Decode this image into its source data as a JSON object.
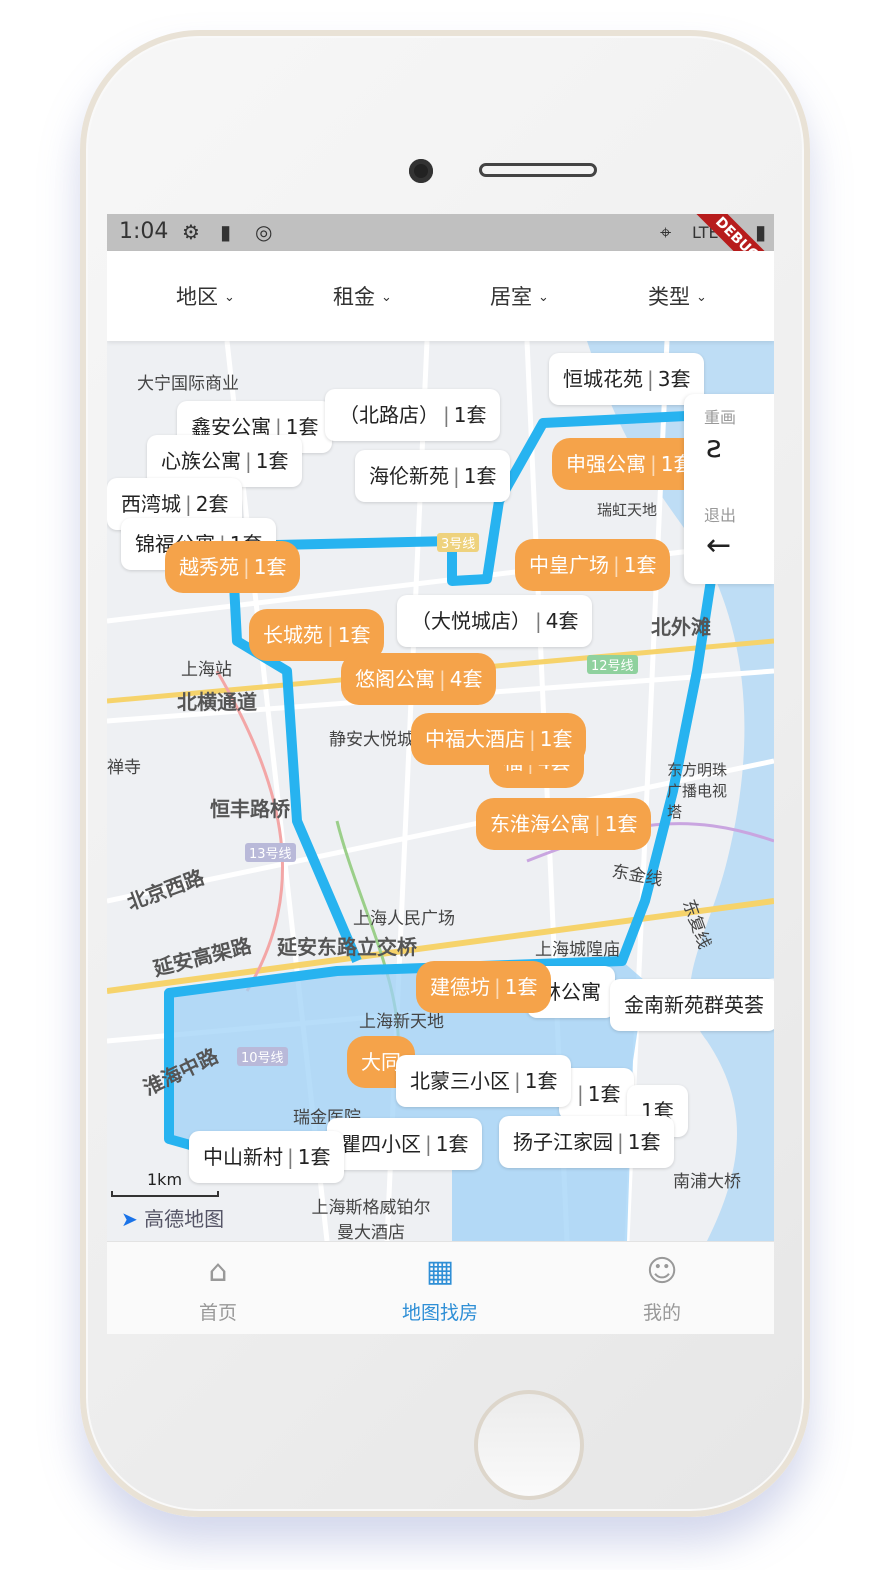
{
  "status_bar": {
    "time": "1:04",
    "network": "LTE",
    "debug_banner": "DEBUG"
  },
  "filters": [
    {
      "label": "地区"
    },
    {
      "label": "租金"
    },
    {
      "label": "居室"
    },
    {
      "label": "类型"
    }
  ],
  "tools": {
    "redraw_label": "重画",
    "exit_label": "退出"
  },
  "map_labels": [
    "大宁国际商业",
    "上海站",
    "北横通道",
    "禅寺",
    "静安大悦城",
    "恒丰路桥",
    "13号线",
    "北京西路",
    "上海人民广场",
    "上海城隍庙",
    "延安高架路",
    "延安东路立交桥",
    "上海新天地",
    "淮海中路",
    "10号线",
    "瑞金医院",
    "上海斯格威铂尔曼大酒店",
    "南浦大桥",
    "北外滩",
    "东方明珠广播电视塔",
    "12号线",
    "3号线",
    "东金线",
    "东复线",
    "瑞虹天地",
    "西湾城"
  ],
  "markers": [
    {
      "name": "恒城花苑",
      "count": "3套",
      "style": "white"
    },
    {
      "name": "鑫安公寓",
      "count": "1套",
      "style": "white"
    },
    {
      "name": "（北路店）",
      "count": "1套",
      "style": "white"
    },
    {
      "name": "心族公寓",
      "count": "1套",
      "style": "white"
    },
    {
      "name": "海伦新苑",
      "count": "1套",
      "style": "white"
    },
    {
      "name": "申强公寓",
      "count": "1套",
      "style": "orange"
    },
    {
      "name": "西湾城",
      "count": "2套",
      "style": "white"
    },
    {
      "name": "锦福公寓",
      "count": "1套",
      "style": "white"
    },
    {
      "name": "越秀苑",
      "count": "1套",
      "style": "orange"
    },
    {
      "name": "中皇广场",
      "count": "1套",
      "style": "orange"
    },
    {
      "name": "（大悦城店）",
      "count": "4套",
      "style": "white"
    },
    {
      "name": "长城苑",
      "count": "1套",
      "style": "orange"
    },
    {
      "name": "悠阁公寓",
      "count": "4套",
      "style": "orange"
    },
    {
      "name": "中福大酒店",
      "count": "1套",
      "style": "orange"
    },
    {
      "name": "福",
      "count": "4套",
      "style": "orange"
    },
    {
      "name": "东淮海公寓",
      "count": "1套",
      "style": "orange"
    },
    {
      "name": "建德坊",
      "count": "1套",
      "style": "orange"
    },
    {
      "name": "林公寓",
      "count": "",
      "style": "white"
    },
    {
      "name": "金南新苑群英荟",
      "count": "",
      "style": "white"
    },
    {
      "name": "北蒙三小区",
      "count": "1套",
      "style": "white"
    },
    {
      "name": "大同",
      "count": "",
      "style": "orange"
    },
    {
      "name": "中山新村",
      "count": "1套",
      "style": "white"
    },
    {
      "name": "扬子江家园",
      "count": "1套",
      "style": "white"
    },
    {
      "name": "瞿四小区",
      "count": "1套",
      "style": "white"
    },
    {
      "name": "",
      "count": "1套",
      "style": "white"
    },
    {
      "name": "",
      "count": "1套",
      "style": "white"
    }
  ],
  "scale_label": "1km",
  "map_provider": "高德地图",
  "tabs": [
    {
      "label": "首页",
      "icon": "home-icon"
    },
    {
      "label": "地图找房",
      "icon": "map-icon"
    },
    {
      "label": "我的",
      "icon": "user-icon"
    }
  ],
  "colors": {
    "accent": "#2f8fd6",
    "marker_orange": "#f5a34a",
    "region_fill": "#9fd2f7",
    "region_stroke": "#27b3f0"
  }
}
